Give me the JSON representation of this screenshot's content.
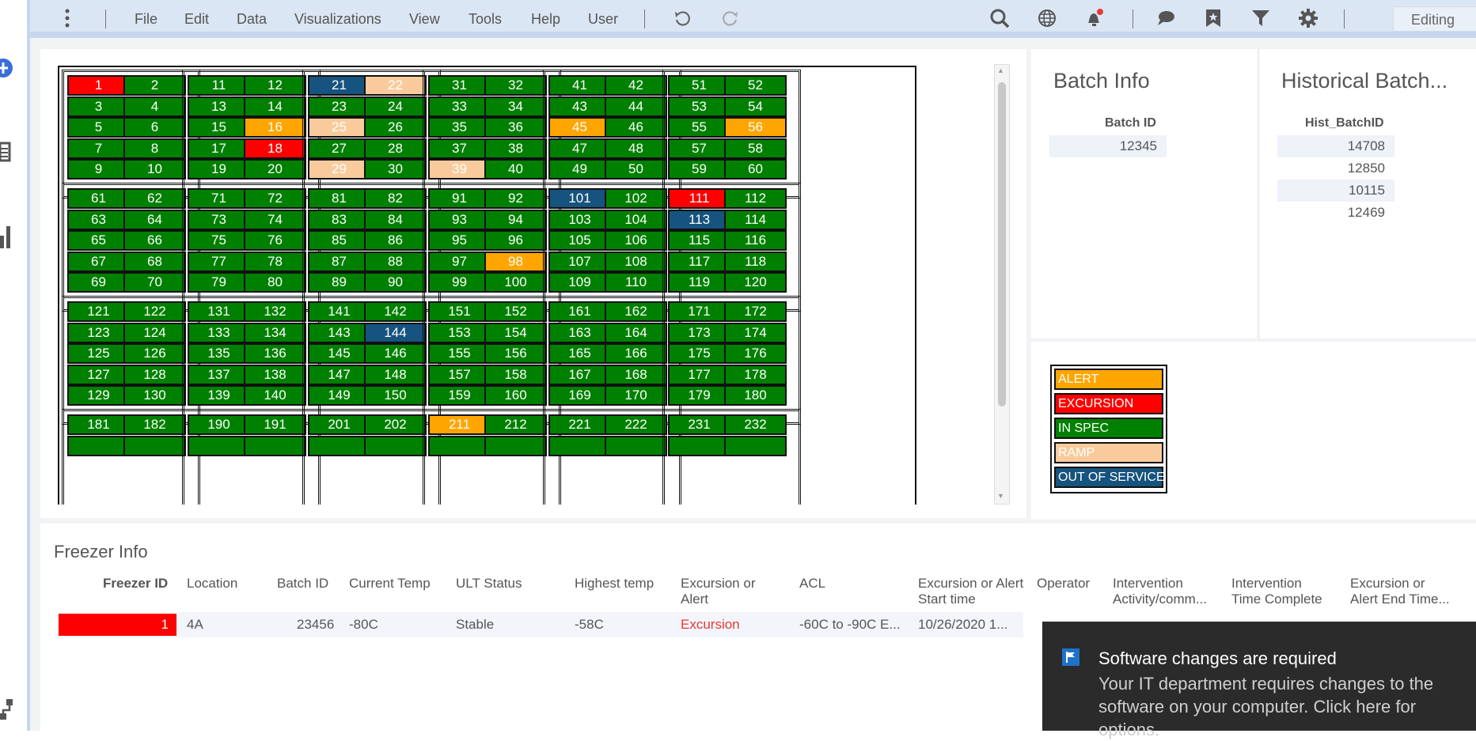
{
  "menu": {
    "items": [
      "File",
      "Edit",
      "Data",
      "Visualizations",
      "View",
      "Tools",
      "Help",
      "User"
    ],
    "mode": "Editing"
  },
  "icons": {
    "left_rail": [
      "add-icon",
      "list-icon",
      "bar-chart-icon",
      "hierarchy-icon"
    ],
    "toolbar": [
      "more-vertical-icon",
      "undo-icon",
      "redo-icon",
      "search-icon",
      "globe-icon",
      "notification-bell-icon",
      "comment-icon",
      "bookmark-icon",
      "filter-icon",
      "gear-icon",
      "chevron-down-icon"
    ]
  },
  "status_colors": {
    "ALERT": "#ffa500",
    "EXCURSION": "#ff0000",
    "IN SPEC": "#008000",
    "RAMP": "#f9cb9c",
    "OUT OF SERVICE": "#16537e"
  },
  "freezer_grid": {
    "racks": [
      [
        {
          "cells": [
            [
              "1",
              "EXCURSION"
            ],
            [
              "2",
              "IN SPEC"
            ],
            [
              "3",
              "IN SPEC"
            ],
            [
              "4",
              "IN SPEC"
            ],
            [
              "5",
              "IN SPEC"
            ],
            [
              "6",
              "IN SPEC"
            ],
            [
              "7",
              "IN SPEC"
            ],
            [
              "8",
              "IN SPEC"
            ],
            [
              "9",
              "IN SPEC"
            ],
            [
              "10",
              "IN SPEC"
            ]
          ]
        },
        {
          "cells": [
            [
              "11",
              "IN SPEC"
            ],
            [
              "12",
              "IN SPEC"
            ],
            [
              "13",
              "IN SPEC"
            ],
            [
              "14",
              "IN SPEC"
            ],
            [
              "15",
              "IN SPEC"
            ],
            [
              "16",
              "ALERT"
            ],
            [
              "17",
              "IN SPEC"
            ],
            [
              "18",
              "EXCURSION"
            ],
            [
              "19",
              "IN SPEC"
            ],
            [
              "20",
              "IN SPEC"
            ]
          ]
        },
        {
          "cells": [
            [
              "21",
              "OUT OF SERVICE"
            ],
            [
              "22",
              "RAMP"
            ],
            [
              "23",
              "IN SPEC"
            ],
            [
              "24",
              "IN SPEC"
            ],
            [
              "25",
              "RAMP"
            ],
            [
              "26",
              "IN SPEC"
            ],
            [
              "27",
              "IN SPEC"
            ],
            [
              "28",
              "IN SPEC"
            ],
            [
              "29",
              "RAMP"
            ],
            [
              "30",
              "IN SPEC"
            ]
          ]
        },
        {
          "cells": [
            [
              "31",
              "IN SPEC"
            ],
            [
              "32",
              "IN SPEC"
            ],
            [
              "33",
              "IN SPEC"
            ],
            [
              "34",
              "IN SPEC"
            ],
            [
              "35",
              "IN SPEC"
            ],
            [
              "36",
              "IN SPEC"
            ],
            [
              "37",
              "IN SPEC"
            ],
            [
              "38",
              "IN SPEC"
            ],
            [
              "39",
              "RAMP"
            ],
            [
              "40",
              "IN SPEC"
            ]
          ]
        },
        {
          "cells": [
            [
              "41",
              "IN SPEC"
            ],
            [
              "42",
              "IN SPEC"
            ],
            [
              "43",
              "IN SPEC"
            ],
            [
              "44",
              "IN SPEC"
            ],
            [
              "45",
              "ALERT"
            ],
            [
              "46",
              "IN SPEC"
            ],
            [
              "47",
              "IN SPEC"
            ],
            [
              "48",
              "IN SPEC"
            ],
            [
              "49",
              "IN SPEC"
            ],
            [
              "50",
              "IN SPEC"
            ]
          ]
        },
        {
          "cells": [
            [
              "51",
              "IN SPEC"
            ],
            [
              "52",
              "IN SPEC"
            ],
            [
              "53",
              "IN SPEC"
            ],
            [
              "54",
              "IN SPEC"
            ],
            [
              "55",
              "IN SPEC"
            ],
            [
              "56",
              "ALERT"
            ],
            [
              "57",
              "IN SPEC"
            ],
            [
              "58",
              "IN SPEC"
            ],
            [
              "59",
              "IN SPEC"
            ],
            [
              "60",
              "IN SPEC"
            ]
          ]
        }
      ],
      [
        {
          "cells": [
            [
              "61",
              "IN SPEC"
            ],
            [
              "62",
              "IN SPEC"
            ],
            [
              "63",
              "IN SPEC"
            ],
            [
              "64",
              "IN SPEC"
            ],
            [
              "65",
              "IN SPEC"
            ],
            [
              "66",
              "IN SPEC"
            ],
            [
              "67",
              "IN SPEC"
            ],
            [
              "68",
              "IN SPEC"
            ],
            [
              "69",
              "IN SPEC"
            ],
            [
              "70",
              "IN SPEC"
            ]
          ]
        },
        {
          "cells": [
            [
              "71",
              "IN SPEC"
            ],
            [
              "72",
              "IN SPEC"
            ],
            [
              "73",
              "IN SPEC"
            ],
            [
              "74",
              "IN SPEC"
            ],
            [
              "75",
              "IN SPEC"
            ],
            [
              "76",
              "IN SPEC"
            ],
            [
              "77",
              "IN SPEC"
            ],
            [
              "78",
              "IN SPEC"
            ],
            [
              "79",
              "IN SPEC"
            ],
            [
              "80",
              "IN SPEC"
            ]
          ]
        },
        {
          "cells": [
            [
              "81",
              "IN SPEC"
            ],
            [
              "82",
              "IN SPEC"
            ],
            [
              "83",
              "IN SPEC"
            ],
            [
              "84",
              "IN SPEC"
            ],
            [
              "85",
              "IN SPEC"
            ],
            [
              "86",
              "IN SPEC"
            ],
            [
              "87",
              "IN SPEC"
            ],
            [
              "88",
              "IN SPEC"
            ],
            [
              "89",
              "IN SPEC"
            ],
            [
              "90",
              "IN SPEC"
            ]
          ]
        },
        {
          "cells": [
            [
              "91",
              "IN SPEC"
            ],
            [
              "92",
              "IN SPEC"
            ],
            [
              "93",
              "IN SPEC"
            ],
            [
              "94",
              "IN SPEC"
            ],
            [
              "95",
              "IN SPEC"
            ],
            [
              "96",
              "IN SPEC"
            ],
            [
              "97",
              "IN SPEC"
            ],
            [
              "98",
              "ALERT"
            ],
            [
              "99",
              "IN SPEC"
            ],
            [
              "100",
              "IN SPEC"
            ]
          ]
        },
        {
          "cells": [
            [
              "101",
              "OUT OF SERVICE"
            ],
            [
              "102",
              "IN SPEC"
            ],
            [
              "103",
              "IN SPEC"
            ],
            [
              "104",
              "IN SPEC"
            ],
            [
              "105",
              "IN SPEC"
            ],
            [
              "106",
              "IN SPEC"
            ],
            [
              "107",
              "IN SPEC"
            ],
            [
              "108",
              "IN SPEC"
            ],
            [
              "109",
              "IN SPEC"
            ],
            [
              "110",
              "IN SPEC"
            ]
          ]
        },
        {
          "cells": [
            [
              "111",
              "EXCURSION"
            ],
            [
              "112",
              "IN SPEC"
            ],
            [
              "113",
              "OUT OF SERVICE"
            ],
            [
              "114",
              "IN SPEC"
            ],
            [
              "115",
              "IN SPEC"
            ],
            [
              "116",
              "IN SPEC"
            ],
            [
              "117",
              "IN SPEC"
            ],
            [
              "118",
              "IN SPEC"
            ],
            [
              "119",
              "IN SPEC"
            ],
            [
              "120",
              "IN SPEC"
            ]
          ]
        }
      ],
      [
        {
          "cells": [
            [
              "121",
              "IN SPEC"
            ],
            [
              "122",
              "IN SPEC"
            ],
            [
              "123",
              "IN SPEC"
            ],
            [
              "124",
              "IN SPEC"
            ],
            [
              "125",
              "IN SPEC"
            ],
            [
              "126",
              "IN SPEC"
            ],
            [
              "127",
              "IN SPEC"
            ],
            [
              "128",
              "IN SPEC"
            ],
            [
              "129",
              "IN SPEC"
            ],
            [
              "130",
              "IN SPEC"
            ]
          ]
        },
        {
          "cells": [
            [
              "131",
              "IN SPEC"
            ],
            [
              "132",
              "IN SPEC"
            ],
            [
              "133",
              "IN SPEC"
            ],
            [
              "134",
              "IN SPEC"
            ],
            [
              "135",
              "IN SPEC"
            ],
            [
              "136",
              "IN SPEC"
            ],
            [
              "137",
              "IN SPEC"
            ],
            [
              "138",
              "IN SPEC"
            ],
            [
              "139",
              "IN SPEC"
            ],
            [
              "140",
              "IN SPEC"
            ]
          ]
        },
        {
          "cells": [
            [
              "141",
              "IN SPEC"
            ],
            [
              "142",
              "IN SPEC"
            ],
            [
              "143",
              "IN SPEC"
            ],
            [
              "144",
              "OUT OF SERVICE"
            ],
            [
              "145",
              "IN SPEC"
            ],
            [
              "146",
              "IN SPEC"
            ],
            [
              "147",
              "IN SPEC"
            ],
            [
              "148",
              "IN SPEC"
            ],
            [
              "149",
              "IN SPEC"
            ],
            [
              "150",
              "IN SPEC"
            ]
          ]
        },
        {
          "cells": [
            [
              "151",
              "IN SPEC"
            ],
            [
              "152",
              "IN SPEC"
            ],
            [
              "153",
              "IN SPEC"
            ],
            [
              "154",
              "IN SPEC"
            ],
            [
              "155",
              "IN SPEC"
            ],
            [
              "156",
              "IN SPEC"
            ],
            [
              "157",
              "IN SPEC"
            ],
            [
              "158",
              "IN SPEC"
            ],
            [
              "159",
              "IN SPEC"
            ],
            [
              "160",
              "IN SPEC"
            ]
          ]
        },
        {
          "cells": [
            [
              "161",
              "IN SPEC"
            ],
            [
              "162",
              "IN SPEC"
            ],
            [
              "163",
              "IN SPEC"
            ],
            [
              "164",
              "IN SPEC"
            ],
            [
              "165",
              "IN SPEC"
            ],
            [
              "166",
              "IN SPEC"
            ],
            [
              "167",
              "IN SPEC"
            ],
            [
              "168",
              "IN SPEC"
            ],
            [
              "169",
              "IN SPEC"
            ],
            [
              "170",
              "IN SPEC"
            ]
          ]
        },
        {
          "cells": [
            [
              "171",
              "IN SPEC"
            ],
            [
              "172",
              "IN SPEC"
            ],
            [
              "173",
              "IN SPEC"
            ],
            [
              "174",
              "IN SPEC"
            ],
            [
              "175",
              "IN SPEC"
            ],
            [
              "176",
              "IN SPEC"
            ],
            [
              "177",
              "IN SPEC"
            ],
            [
              "178",
              "IN SPEC"
            ],
            [
              "179",
              "IN SPEC"
            ],
            [
              "180",
              "IN SPEC"
            ]
          ]
        }
      ],
      [
        {
          "cells": [
            [
              "181",
              "IN SPEC"
            ],
            [
              "182",
              "IN SPEC"
            ],
            [
              "",
              "IN SPEC"
            ],
            [
              "",
              "IN SPEC"
            ]
          ]
        },
        {
          "cells": [
            [
              "190",
              "IN SPEC"
            ],
            [
              "191",
              "IN SPEC"
            ],
            [
              "",
              "IN SPEC"
            ],
            [
              "",
              "IN SPEC"
            ]
          ]
        },
        {
          "cells": [
            [
              "201",
              "IN SPEC"
            ],
            [
              "202",
              "IN SPEC"
            ],
            [
              "",
              "IN SPEC"
            ],
            [
              "",
              "IN SPEC"
            ]
          ]
        },
        {
          "cells": [
            [
              "211",
              "ALERT"
            ],
            [
              "212",
              "IN SPEC"
            ],
            [
              "",
              "IN SPEC"
            ],
            [
              "",
              "IN SPEC"
            ]
          ]
        },
        {
          "cells": [
            [
              "221",
              "IN SPEC"
            ],
            [
              "222",
              "IN SPEC"
            ],
            [
              "",
              "IN SPEC"
            ],
            [
              "",
              "IN SPEC"
            ]
          ]
        },
        {
          "cells": [
            [
              "231",
              "IN SPEC"
            ],
            [
              "232",
              "IN SPEC"
            ],
            [
              "",
              "IN SPEC"
            ],
            [
              "",
              "IN SPEC"
            ]
          ]
        }
      ]
    ]
  },
  "batch_info": {
    "title": "Batch Info",
    "column": "Batch ID",
    "values": [
      "12345"
    ]
  },
  "historical_batch": {
    "title": "Historical Batch...",
    "column": "Hist_BatchID",
    "values": [
      "14708",
      "12850",
      "10115",
      "12469"
    ]
  },
  "legend": [
    "ALERT",
    "EXCURSION",
    "IN SPEC",
    "RAMP",
    "OUT OF SERVICE"
  ],
  "freezer_info": {
    "title": "Freezer Info",
    "headers": [
      "Freezer ID",
      "Location",
      "Batch ID",
      "Current Temp",
      "ULT Status",
      "Highest temp",
      "Excursion or Alert",
      "ACL",
      "Excursion or Alert Start time",
      "Operator",
      "Intervention Activity/comm...",
      "Intervention Time Complete",
      "Excursion or Alert End Time..."
    ],
    "row": {
      "freezer_id": "1",
      "location": "4A",
      "batch_id": "23456",
      "current_temp": "-80C",
      "ult_status": "Stable",
      "highest_temp": "-58C",
      "excursion_or_alert": "Excursion",
      "acl": "-60C to -90C E...",
      "start_time": "10/26/2020 1..."
    }
  },
  "toast": {
    "title": "Software changes are required",
    "body": "Your IT department requires changes to the software on your computer. Click here for options."
  }
}
